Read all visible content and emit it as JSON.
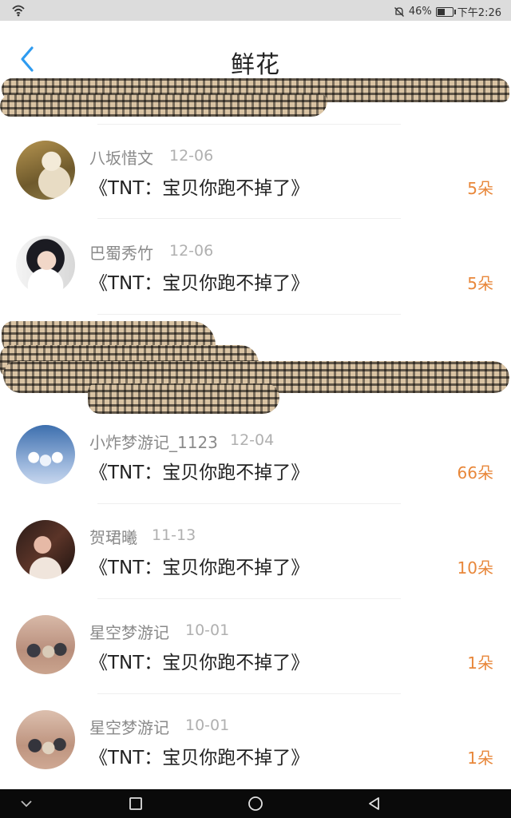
{
  "status": {
    "battery": "46%",
    "time": "下午2:26"
  },
  "header": {
    "title": "鲜花"
  },
  "rows": [
    {
      "name": "八坂惜文",
      "date": "12-06",
      "book": "《TNT：宝贝你跑不掉了》",
      "count": "5朵"
    },
    {
      "name": "巴蜀秀竹",
      "date": "12-06",
      "book": "《TNT：宝贝你跑不掉了》",
      "count": "5朵"
    },
    {
      "name": "小炸梦游记_1123",
      "date": "12-04",
      "book": "《TNT：宝贝你跑不掉了》",
      "count": "66朵"
    },
    {
      "name": "贺珺曦",
      "date": "11-13",
      "book": "《TNT：宝贝你跑不掉了》",
      "count": "10朵"
    },
    {
      "name": "星空梦游记",
      "date": "10-01",
      "book": "《TNT：宝贝你跑不掉了》",
      "count": "1朵"
    },
    {
      "name": "星空梦游记",
      "date": "10-01",
      "book": "《TNT：宝贝你跑不掉了》",
      "count": "1朵"
    }
  ],
  "colors": {
    "accent": "#2e9bf0",
    "count": "#e8873a"
  },
  "icons": [
    "wifi-icon",
    "mute-bell-icon",
    "battery-icon",
    "back-arrow-icon",
    "nav-back-icon",
    "nav-home-icon",
    "nav-recent-icon",
    "nav-collapse-icon"
  ]
}
